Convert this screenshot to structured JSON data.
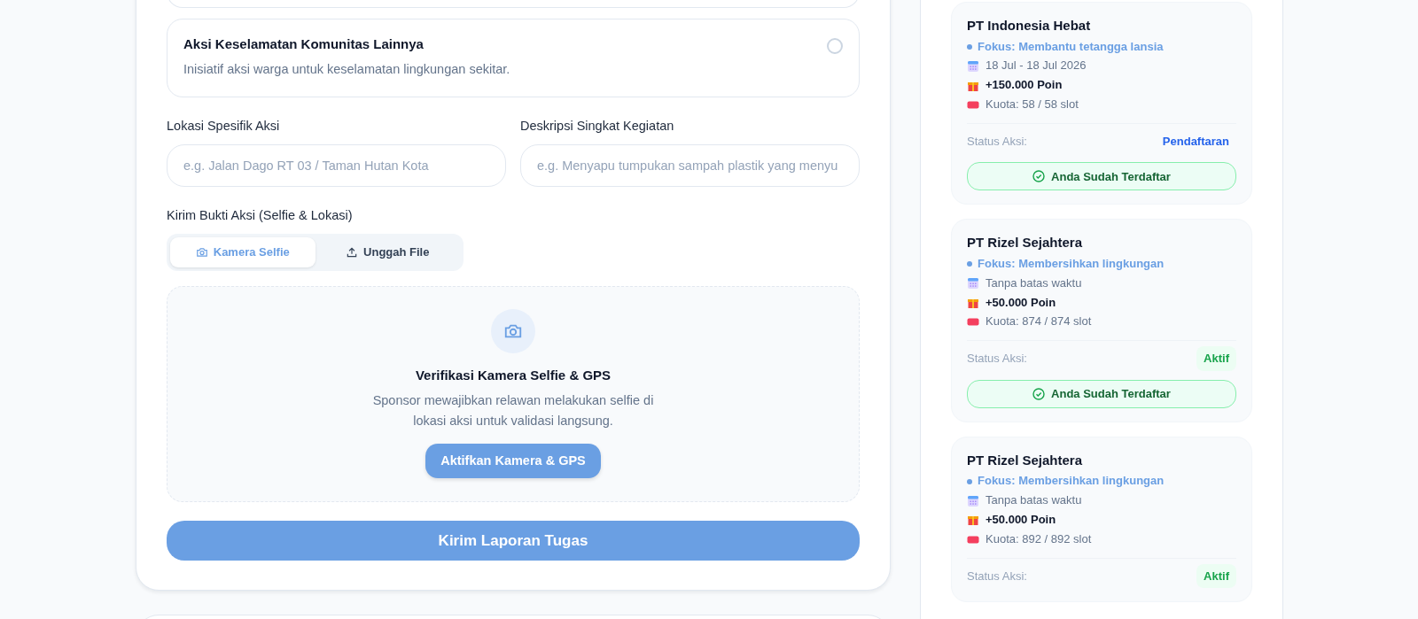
{
  "form": {
    "options": [
      {
        "title": "Aksi Keselamatan Komunitas Lainnya",
        "description": "Inisiatif aksi warga untuk keselamatan lingkungan sekitar.",
        "selected": false
      }
    ],
    "fields": [
      {
        "label": "Lokasi Spesifik Aksi",
        "placeholder": "e.g. Jalan Dago RT 03 / Taman Hutan Kota"
      },
      {
        "label": "Deskripsi Singkat Kegiatan",
        "placeholder": "e.g. Menyapu tumpukan sampah plastik yang menyu"
      }
    ],
    "proof_label": "Kirim Bukti Aksi (Selfie & Lokasi)",
    "proof_tabs": [
      {
        "label": "Kamera Selfie",
        "kind": "camera",
        "selected": true
      },
      {
        "label": "Unggah File",
        "kind": "upload",
        "selected": false
      }
    ],
    "camera_panel": {
      "title": "Verifikasi Kamera Selfie & GPS",
      "text": "Sponsor mewajibkan relawan melakukan selfie di lokasi aksi untuk validasi langsung.",
      "button": "Aktifkan Kamera & GPS"
    },
    "submit": "Kirim Laporan Tugas"
  },
  "sponsors": [
    {
      "name": "PT Indonesia Hebat",
      "focus": "Fokus: Membantu tetangga lansia",
      "date": "18 Jul - 18 Jul 2026",
      "points": "+150.000 Poin",
      "quota": "Kuota: 58 / 58 slot",
      "status_label": "Status Aksi:",
      "status": "Pendaftaran",
      "status_filled": false,
      "registered": "Anda Sudah Terdaftar"
    },
    {
      "name": "PT Rizel Sejahtera",
      "focus": "Fokus: Membersihkan lingkungan",
      "date": "Tanpa batas waktu",
      "points": "+50.000 Poin",
      "quota": "Kuota: 874 / 874 slot",
      "status_label": "Status Aksi:",
      "status": "Aktif",
      "status_filled": true,
      "registered": "Anda Sudah Terdaftar"
    },
    {
      "name": "PT Rizel Sejahtera",
      "focus": "Fokus: Membersihkan lingkungan",
      "date": "Tanpa batas waktu",
      "points": "+50.000 Poin",
      "quota": "Kuota: 892 / 892 slot",
      "status_label": "Status Aksi:",
      "status": "Aktif",
      "status_filled": true
    }
  ]
}
